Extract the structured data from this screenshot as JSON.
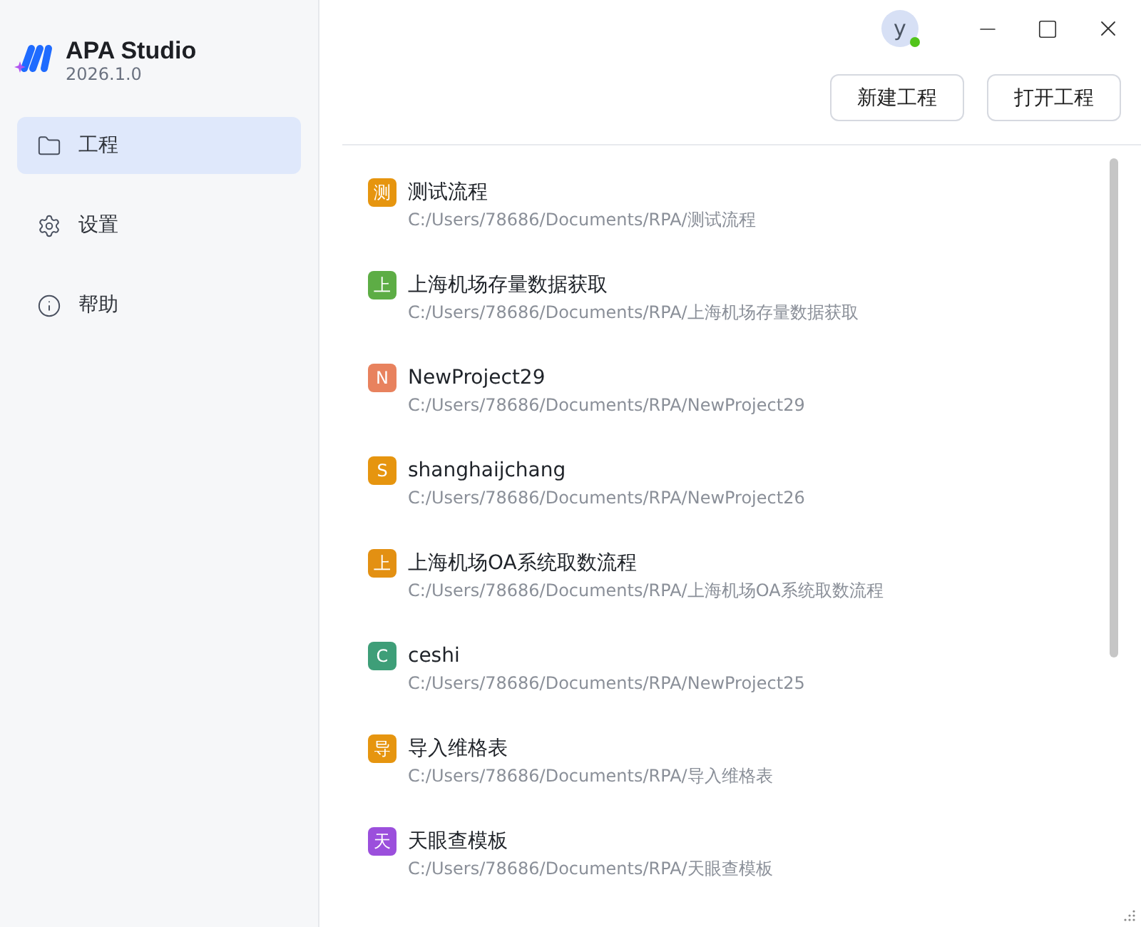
{
  "app": {
    "name": "APA Studio",
    "version": "2026.1.0"
  },
  "sidebar": {
    "items": [
      {
        "label": "工程",
        "kind": "folder",
        "selected": true
      },
      {
        "label": "设置",
        "kind": "settings",
        "selected": false
      },
      {
        "label": "帮助",
        "kind": "info",
        "selected": false
      }
    ]
  },
  "user": {
    "avatar": "y",
    "online": true
  },
  "buttons": [
    "新建工程",
    "打开工程"
  ],
  "projects": [
    {
      "badge": "测",
      "color": "#e6950f",
      "name": "测试流程",
      "path": "C:/Users/78686/Documents/RPA/测试流程"
    },
    {
      "badge": "上",
      "color": "#5dad45",
      "name": "上海机场存量数据获取",
      "path": "C:/Users/78686/Documents/RPA/上海机场存量数据获取"
    },
    {
      "badge": "N",
      "color": "#e8825e",
      "name": "NewProject29",
      "path": "C:/Users/78686/Documents/RPA/NewProject29"
    },
    {
      "badge": "S",
      "color": "#e6950f",
      "name": "shanghaijchang",
      "path": "C:/Users/78686/Documents/RPA/NewProject26"
    },
    {
      "badge": "上",
      "color": "#e39012",
      "name": "上海机场OA系统取数流程",
      "path": "C:/Users/78686/Documents/RPA/上海机场OA系统取数流程"
    },
    {
      "badge": "C",
      "color": "#3e9e78",
      "name": "ceshi",
      "path": "C:/Users/78686/Documents/RPA/NewProject25"
    },
    {
      "badge": "导",
      "color": "#e6950f",
      "name": "导入维格表",
      "path": "C:/Users/78686/Documents/RPA/导入维格表"
    },
    {
      "badge": "天",
      "color": "#9b4fdc",
      "name": "天眼查模板",
      "path": "C:/Users/78686/Documents/RPA/天眼查模板"
    }
  ]
}
